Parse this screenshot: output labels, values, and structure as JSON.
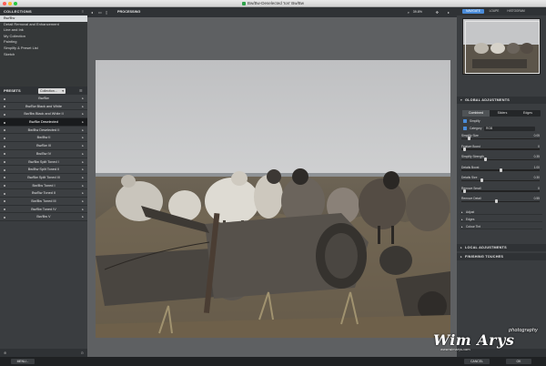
{
  "window": {
    "title": "Bw/Bw-Deselected 'Ion' Bw/Bw",
    "app_color": "#2ea24a"
  },
  "collections": {
    "header": "COLLECTIONS",
    "items": [
      {
        "label": "Bw/Bw",
        "selected": true
      },
      {
        "label": "Detail Removal and Enhancement",
        "selected": false
      },
      {
        "label": "Line and Ink",
        "selected": false
      },
      {
        "label": "My Collection",
        "selected": false
      },
      {
        "label": "Painting",
        "selected": false
      },
      {
        "label": "Simplify & Preset List",
        "selected": false
      },
      {
        "label": "Sketch",
        "selected": false
      }
    ]
  },
  "presets": {
    "header": "PRESETS",
    "dropdown": "Collection...",
    "items": [
      {
        "label": "Bw/Bw",
        "selected": false
      },
      {
        "label": "Bw/Bw Black and White",
        "selected": false
      },
      {
        "label": "Bw/Bw Black and White II",
        "selected": false
      },
      {
        "label": "Bw/Bw Deselected",
        "selected": true
      },
      {
        "label": "Bw/Bw Deselected II",
        "selected": false
      },
      {
        "label": "Bw/Bw II",
        "selected": false
      },
      {
        "label": "Bw/Bw III",
        "selected": false
      },
      {
        "label": "Bw/Bw IV",
        "selected": false
      },
      {
        "label": "Bw/Bw Split Toned I",
        "selected": false
      },
      {
        "label": "Bw/Bw Split Toned II",
        "selected": false
      },
      {
        "label": "Bw/Bw Split Toned III",
        "selected": false
      },
      {
        "label": "Bw/Bw Toned I",
        "selected": false
      },
      {
        "label": "Bw/Bw Toned II",
        "selected": false
      },
      {
        "label": "Bw/Bw Toned III",
        "selected": false
      },
      {
        "label": "Bw/Bw Toned IV",
        "selected": false
      },
      {
        "label": "Bw/Bw V",
        "selected": false
      }
    ]
  },
  "toolbar": {
    "processing": "PROCESSING",
    "zoom": "39.8%"
  },
  "right_tabs": [
    "NAVIGATE",
    "LOUPE",
    "HISTOGRAM"
  ],
  "global": {
    "header": "GLOBAL ADJUSTMENTS",
    "segments": [
      "Combined",
      "Sliders",
      "Edges"
    ],
    "simplify_label": "Simplify",
    "category_label": "Category",
    "category_value": "RGB",
    "sliders": [
      {
        "label": "Simplify Size",
        "value": "0.05",
        "pos": 0.08
      },
      {
        "label": "Feature Boost",
        "value": "0",
        "pos": 0.02
      },
      {
        "label": "Simplify Strength",
        "value": "0.35",
        "pos": 0.3
      },
      {
        "label": "Details Boost",
        "value": "1.00",
        "pos": 0.5
      },
      {
        "label": "Details Size",
        "value": "0.30",
        "pos": 0.25
      },
      {
        "label": "Remove Small",
        "value": "0",
        "pos": 0.02
      },
      {
        "label": "Remove Detail",
        "value": "0.55",
        "pos": 0.45
      }
    ],
    "sub_sections": [
      "Adjust",
      "Edges",
      "Colour Tint"
    ]
  },
  "local": {
    "header": "LOCAL ADJUSTMENTS"
  },
  "finishing": {
    "header": "FINISHING TOUCHES"
  },
  "bottom": {
    "left_button": "MENU...",
    "cancel": "CANCEL",
    "ok": "OK"
  },
  "watermark": {
    "name": "Wim Arys",
    "tag": "photography",
    "url": "www.wimarys.com"
  }
}
